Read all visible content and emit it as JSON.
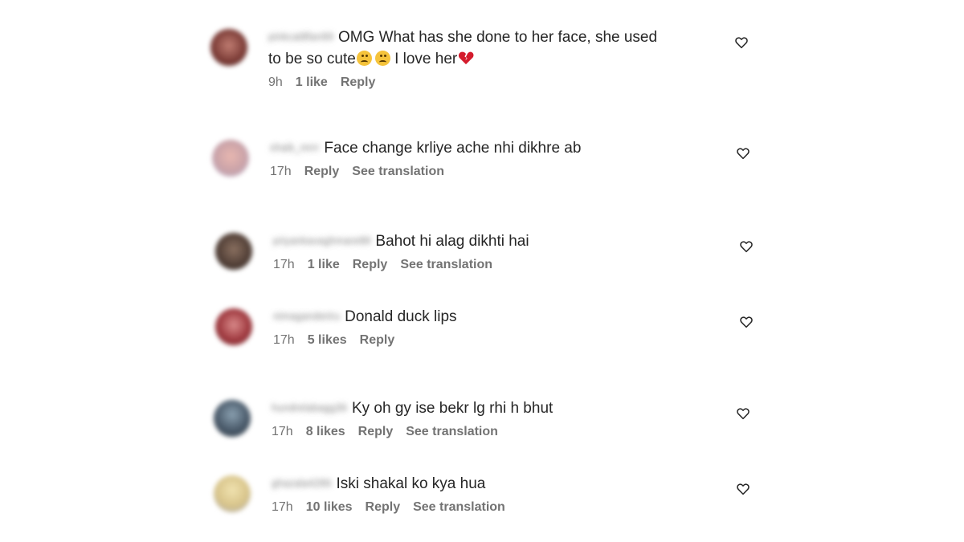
{
  "comments": [
    {
      "username": "pinkcat8fan99",
      "text_line1": "OMG What has she done to her face, she used",
      "text_line2": "to be so cute",
      "text_line2_tail": " I love her",
      "emojis": [
        "sad-face-emoji",
        "sad-face-emoji",
        "broken-heart-emoji"
      ],
      "time": "9h",
      "likes": "1 like",
      "reply": "Reply",
      "translation": "",
      "avatar_color": "#7a3a35"
    },
    {
      "username": "shaik_mrrr",
      "text_line1": "Face change krliye ache nhi dikhre ab",
      "time": "17h",
      "likes": "",
      "reply": "Reply",
      "translation": "See translation",
      "avatar_color": "#c9a2a8"
    },
    {
      "username": "priyankavaghmare88",
      "text_line1": "Bahot hi alag dikhti hai",
      "time": "17h",
      "likes": "1 like",
      "reply": "Reply",
      "translation": "See translation",
      "avatar_color": "#4f3d35"
    },
    {
      "username": "nimaganderiru",
      "text_line1": "Donald duck lips",
      "time": "17h",
      "likes": "5 likes",
      "reply": "Reply",
      "translation": "",
      "avatar_color": "#a03a40"
    },
    {
      "username": "hundrelabagg36",
      "text_line1": "Ky oh gy ise bekr lg rhi h bhut",
      "time": "17h",
      "likes": "8 likes",
      "reply": "Reply",
      "translation": "See translation",
      "avatar_color": "#4a5a6a"
    },
    {
      "username": "ghazala4286",
      "text_line1": "Iski shakal ko kya hua",
      "time": "17h",
      "likes": "10 likes",
      "reply": "Reply",
      "translation": "See translation",
      "avatar_color": "#d8c48a"
    }
  ],
  "icons": {
    "like": "heart-outline-icon"
  },
  "colors": {
    "text": "#262626",
    "meta": "#737373"
  }
}
